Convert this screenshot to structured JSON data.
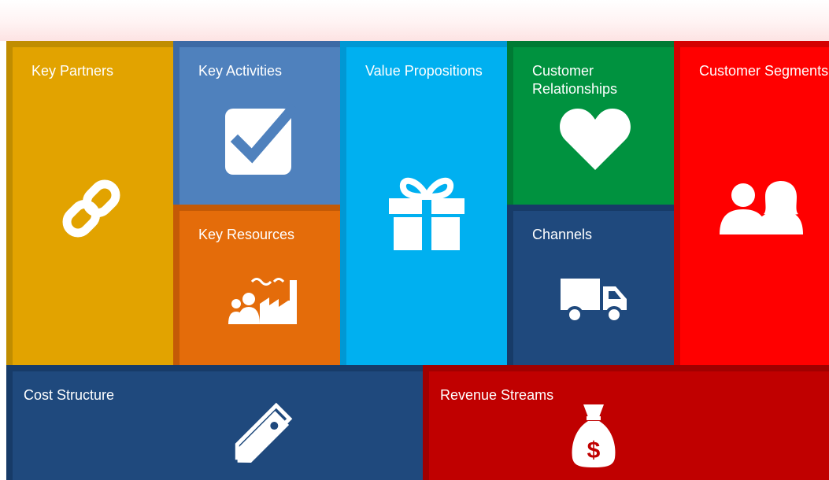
{
  "canvas": {
    "tiles": {
      "key_partners": {
        "label": "Key Partners",
        "icon": "link-icon",
        "color": "#e2a300",
        "border": "#c08d00"
      },
      "key_activities": {
        "label": "Key Activities",
        "icon": "checkbox-checked-icon",
        "color": "#4f81bd",
        "border": "#3d6aa5"
      },
      "key_resources": {
        "label": "Key Resources",
        "icon": "factory-people-icon",
        "color": "#e46c0a",
        "border": "#c45a06"
      },
      "value_propositions": {
        "label": "Value Propositions",
        "icon": "gift-icon",
        "color": "#00b0f0",
        "border": "#0098d4"
      },
      "customer_relationships": {
        "label": "Customer Relationships",
        "icon": "heart-icon",
        "color": "#00923f",
        "border": "#007a34"
      },
      "channels": {
        "label": "Channels",
        "icon": "truck-icon",
        "color": "#1f497d",
        "border": "#173b68"
      },
      "customer_segments": {
        "label": "Customer Segments",
        "icon": "people-icon",
        "color": "#ff0000",
        "border": "#d40000"
      },
      "cost_structure": {
        "label": "Cost Structure",
        "icon": "price-tag-icon",
        "color": "#1f497d",
        "border": "#173b68"
      },
      "revenue_streams": {
        "label": "Revenue Streams",
        "icon": "money-bag-icon",
        "color": "#c00000",
        "border": "#a00000"
      }
    }
  }
}
